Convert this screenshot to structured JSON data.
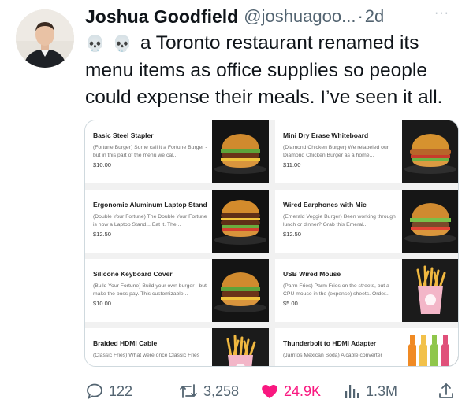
{
  "tweet": {
    "display_name": "Joshua Goodfield",
    "handle": "@joshuagoo...",
    "separator": "·",
    "time": "2d",
    "more": "···",
    "text": "a Toronto restaurant renamed its menu items as office supplies so people could expense their meals. I’ve seen it all."
  },
  "menu": [
    {
      "title": "Basic Steel Stapler",
      "desc": "(Fortune Burger) Some call it a Fortune Burger - but in this part of the menu we cal...",
      "price": "$10.00",
      "image": "burger"
    },
    {
      "title": "Mini Dry Erase Whiteboard",
      "desc": "(Diamond Chicken Burger) We relabeled our Diamond Chicken Burger as a home...",
      "price": "$11.00",
      "image": "chicken-burger"
    },
    {
      "title": "Ergonomic Aluminum Laptop Stand",
      "desc": "(Double Your Fortune) The Double Your Fortune is now a Laptop Stand... Eat it. The...",
      "price": "$12.50",
      "image": "double-burger"
    },
    {
      "title": "Wired Earphones with Mic",
      "desc": "(Emerald Veggie Burger) Been working through lunch or dinner? Grab this Emeral...",
      "price": "$12.50",
      "image": "veggie-burger"
    },
    {
      "title": "Silicone Keyboard Cover",
      "desc": "(Build Your Fortune) Build your own burger - but make the boss pay. This customizable...",
      "price": "$10.00",
      "image": "burger"
    },
    {
      "title": "USB Wired Mouse",
      "desc": "(Parm Fries) Parm Fries on the streets, but a CPU mouse in the (expense) sheets. Order...",
      "price": "$5.00",
      "image": "fries"
    },
    {
      "title": "Braided HDMI Cable",
      "desc": "(Classic Fries) What were once Classic Fries",
      "price": "",
      "image": "fries"
    },
    {
      "title": "Thunderbolt to HDMI Adapter",
      "desc": "(Jarritos Mexican Soda) A cable converter",
      "price": "",
      "image": "sodas"
    }
  ],
  "actions": {
    "replies": "122",
    "retweets": "3,258",
    "likes": "24.9K",
    "views": "1.3M"
  },
  "colors": {
    "like": "#f91880",
    "muted": "#536471",
    "text": "#0f1419"
  }
}
